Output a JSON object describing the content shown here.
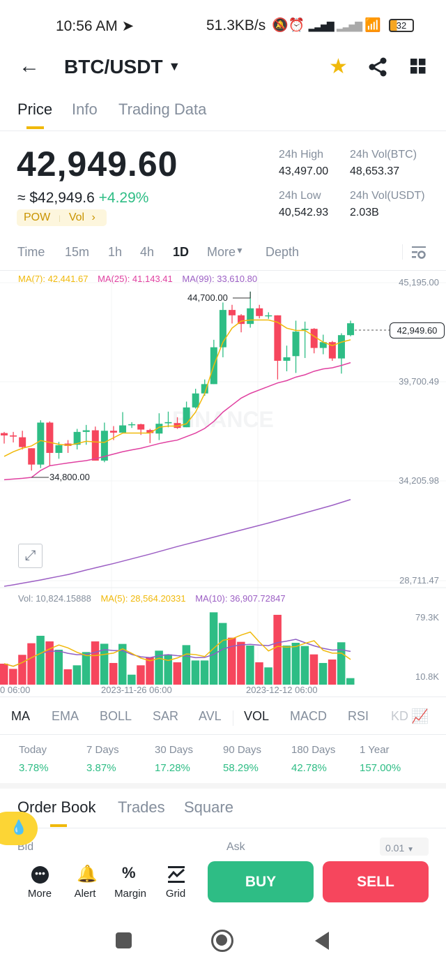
{
  "status_bar": {
    "time": "10:56 AM",
    "net_speed": "51.3KB/s",
    "battery": "32"
  },
  "header": {
    "pair": "BTC/USDT",
    "favorite": true
  },
  "tabs": [
    "Price",
    "Info",
    "Trading Data"
  ],
  "active_tab": "Price",
  "price": {
    "last": "42,949.60",
    "usd": "≈ $42,949.6",
    "change": "+4.29%",
    "tags": [
      "POW",
      "Vol"
    ],
    "stats": [
      {
        "label": "24h High",
        "value": "43,497.00"
      },
      {
        "label": "24h Vol(BTC)",
        "value": "48,653.37"
      },
      {
        "label": "24h Low",
        "value": "40,542.93"
      },
      {
        "label": "24h Vol(USDT)",
        "value": "2.03B"
      }
    ]
  },
  "timeframes": [
    "Time",
    "15m",
    "1h",
    "4h",
    "1D",
    "More",
    "Depth"
  ],
  "active_timeframe": "1D",
  "colors": {
    "up": "#2ebd85",
    "down": "#f6465d",
    "accent": "#f0b90b",
    "ma7": "#f0b90b",
    "ma25": "#e040a0",
    "ma99": "#9c5fc4",
    "vol_ma5": "#f0b90b",
    "vol_ma10": "#8e5fc4"
  },
  "chart_data": [
    {
      "type": "candlestick",
      "legend": {
        "ma7": "MA(7): 42,441.67",
        "ma25": "MA(25): 41,143.41",
        "ma99": "MA(99): 33,610.80"
      },
      "y_ticks": [
        "45,195.00",
        "39,700.49",
        "34,205.98",
        "28,711.47"
      ],
      "ylim": [
        28711.47,
        45195.0
      ],
      "annotations": {
        "high": "44,700.00",
        "low": "34,800.00",
        "last": "42,949.60"
      },
      "watermark": "BINANCE",
      "ohlc": [
        [
          36874,
          36939,
          36294,
          36745
        ],
        [
          36745,
          36939,
          36358,
          36681
        ],
        [
          36642,
          37003,
          35971,
          36100
        ],
        [
          36036,
          36036,
          34800,
          35133
        ],
        [
          35133,
          37584,
          34939,
          37455
        ],
        [
          37455,
          37519,
          35068,
          35778
        ],
        [
          35778,
          36384,
          35455,
          36203
        ],
        [
          36294,
          36487,
          35778,
          36165
        ],
        [
          36229,
          37107,
          35971,
          36939
        ],
        [
          36939,
          37326,
          36229,
          37029
        ],
        [
          37029,
          37235,
          35352,
          35352
        ],
        [
          35352,
          37455,
          35262,
          37003
        ],
        [
          37003,
          37261,
          36487,
          36900
        ],
        [
          36900,
          38035,
          36874,
          37300
        ],
        [
          37326,
          37480,
          37158,
          37364
        ],
        [
          37364,
          37390,
          36771,
          37068
        ],
        [
          37042,
          37107,
          36319,
          36874
        ],
        [
          36848,
          37970,
          36487,
          37390
        ],
        [
          37416,
          38061,
          37197,
          37480
        ],
        [
          37429,
          37751,
          37107,
          37158
        ],
        [
          37197,
          38616,
          37197,
          38293
        ],
        [
          38293,
          39325,
          38229,
          39067
        ],
        [
          39067,
          39841,
          38938,
          39583
        ],
        [
          39583,
          42034,
          39583,
          41621
        ],
        [
          41621,
          44098,
          41067,
          43685
        ],
        [
          43685,
          43969,
          42937,
          43388
        ],
        [
          43388,
          43453,
          42447,
          42911
        ],
        [
          42911,
          44700,
          42705,
          43775
        ],
        [
          43775,
          43969,
          43221,
          43350
        ],
        [
          43363,
          43556,
          43195,
          43388
        ],
        [
          43388,
          43388,
          39841,
          40873
        ],
        [
          40873,
          41712,
          40293,
          41067
        ],
        [
          41131,
          43092,
          40202,
          42486
        ],
        [
          42576,
          43040,
          41028,
          42640
        ],
        [
          42640,
          42679,
          41286,
          41583
        ],
        [
          41583,
          42318,
          41235,
          41905
        ],
        [
          41905,
          41970,
          40873,
          41002
        ],
        [
          41002,
          42395,
          40164,
          42292
        ],
        [
          42292,
          43092,
          42228,
          42949.6
        ]
      ],
      "ma7": [
        35584,
        35842,
        36036,
        36165,
        36461,
        36358,
        36255,
        36203,
        36294,
        36423,
        36384,
        36358,
        36616,
        36874,
        36874,
        36874,
        36874,
        37197,
        37261,
        37261,
        37390,
        38035,
        39067,
        40615,
        41905,
        42679,
        43066,
        43130,
        43130,
        43130,
        43001,
        42679,
        42550,
        42550,
        42228,
        41905,
        41712,
        41905,
        42034
      ],
      "ma25": [
        34294,
        34333,
        34371,
        34423,
        34810,
        35068,
        35146,
        35223,
        35287,
        35352,
        35455,
        35584,
        35713,
        35842,
        35945,
        36036,
        36165,
        36294,
        36397,
        36487,
        36681,
        36874,
        37132,
        37519,
        38035,
        38422,
        38809,
        39067,
        39261,
        39454,
        39648,
        39777,
        39970,
        40099,
        40293,
        40422,
        40486,
        40615,
        40770
      ],
      "ma99": [
        28400,
        28480,
        28570,
        28660,
        28750,
        28850,
        28950,
        29050,
        29170,
        29300,
        29420,
        29540,
        29660,
        29790,
        29920,
        30050,
        30180,
        30320,
        30460,
        30600,
        30730,
        30860,
        30990,
        31120,
        31250,
        31380,
        31510,
        31640,
        31770,
        31900,
        32040,
        32180,
        32320,
        32460,
        32600,
        32740,
        32880,
        33040,
        33200
      ]
    },
    {
      "type": "bar",
      "legend": {
        "vol": "Vol: 10,824.15888",
        "ma5": "MA(5): 28,564.20331",
        "ma10": "MA(10): 36,907.72847"
      },
      "y_ticks": [
        "79.3K",
        "10.8K"
      ],
      "x_ticks": [
        "0 06:00",
        "2023-11-26 06:00",
        "2023-12-12 06:00"
      ],
      "unit": "K",
      "values": [
        27.5,
        21.5,
        37.7,
        51.1,
        59.7,
        53.2,
        43.6,
        21.0,
        25.6,
        40.9,
        53.2,
        50.5,
        28.3,
        50.3,
        14.8,
        25.6,
        35.0,
        42.5,
        38.2,
        29.1,
        48.9,
        31.2,
        31.2,
        86.8,
        74.5,
        57.5,
        52.7,
        48.4,
        29.1,
        23.2,
        83.9,
        48.4,
        51.6,
        47.9,
        38.2,
        28.3,
        32.3,
        52.2,
        10.8
      ]
    }
  ],
  "indicators": [
    "MA",
    "EMA",
    "BOLL",
    "SAR",
    "AVL",
    "VOL",
    "MACD",
    "RSI",
    "KD"
  ],
  "active_indicators": [
    "MA",
    "VOL"
  ],
  "performance": [
    {
      "label": "Today",
      "value": "3.78%"
    },
    {
      "label": "7 Days",
      "value": "3.87%"
    },
    {
      "label": "30 Days",
      "value": "17.28%"
    },
    {
      "label": "90 Days",
      "value": "58.29%"
    },
    {
      "label": "180 Days",
      "value": "42.78%"
    },
    {
      "label": "1 Year",
      "value": "157.00%"
    }
  ],
  "bottom_tabs": [
    "Order Book",
    "Trades",
    "Square"
  ],
  "order_book": {
    "bid": "Bid",
    "ask": "Ask",
    "precision": "0.01"
  },
  "actions": {
    "more": "More",
    "alert": "Alert",
    "margin": "Margin",
    "grid": "Grid",
    "buy": "BUY",
    "sell": "SELL"
  }
}
